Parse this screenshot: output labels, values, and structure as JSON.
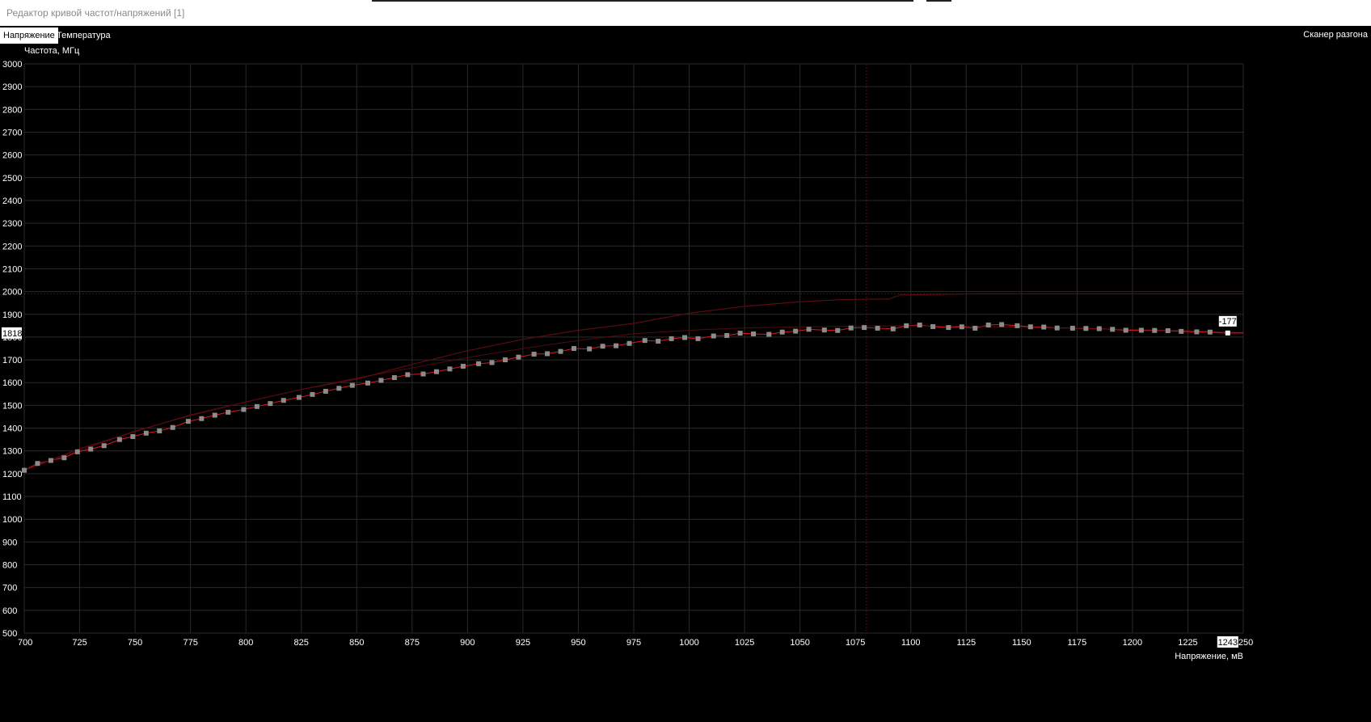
{
  "window": {
    "title": "Редактор кривой частот/напряжений [1]"
  },
  "tabs": [
    {
      "label": "Напряжение",
      "active": true
    },
    {
      "label": "Температура",
      "active": false
    }
  ],
  "toolbar": {
    "scanner_label": "Сканер разгона"
  },
  "colors": {
    "background": "#000000",
    "grid": "#2a2a2a",
    "curve": "#e0141e",
    "curve_dim": "#5a0c10",
    "point": "#8c8c8c",
    "point_selected": "#ffffff"
  },
  "chart_data": {
    "type": "line",
    "ylabel": "Частота, МГц",
    "xlabel": "Напряжение, мВ",
    "xlim": [
      700,
      1250
    ],
    "ylim": [
      500,
      3000
    ],
    "x_ticks": [
      700,
      725,
      750,
      775,
      800,
      825,
      850,
      875,
      900,
      925,
      950,
      975,
      1000,
      1025,
      1050,
      1075,
      1100,
      1125,
      1150,
      1175,
      1200,
      1225,
      1250
    ],
    "y_ticks": [
      500,
      600,
      700,
      800,
      900,
      1000,
      1100,
      1200,
      1300,
      1400,
      1500,
      1600,
      1700,
      1800,
      1900,
      2000,
      2100,
      2200,
      2300,
      2400,
      2500,
      2600,
      2700,
      2800,
      2900,
      3000
    ],
    "grid": true,
    "frequency_limit_mhz": 1990,
    "temperature_limit_voltage_mv": 1080,
    "selected_point": {
      "voltage_mv": 1243,
      "frequency_mhz": 1818,
      "offset_label": "-177"
    },
    "series": [
      {
        "name": "",
        "role": "edited_curve",
        "x": [
          700,
          706,
          712,
          718,
          724,
          730,
          736,
          743,
          749,
          755,
          761,
          767,
          774,
          780,
          786,
          792,
          799,
          805,
          811,
          817,
          824,
          830,
          836,
          842,
          848,
          855,
          861,
          867,
          873,
          880,
          886,
          892,
          898,
          905,
          911,
          917,
          923,
          930,
          936,
          942,
          948,
          955,
          961,
          967,
          973,
          980,
          986,
          992,
          998,
          1004,
          1011,
          1017,
          1023,
          1029,
          1036,
          1042,
          1048,
          1054,
          1061,
          1067,
          1073,
          1079,
          1085,
          1092,
          1098,
          1104,
          1110,
          1117,
          1123,
          1129,
          1135,
          1141,
          1148,
          1154,
          1160,
          1166,
          1173,
          1179,
          1185,
          1191,
          1197,
          1204,
          1210,
          1216,
          1222,
          1229,
          1235,
          1241
        ],
        "y": [
          1215,
          1245,
          1258,
          1270,
          1296,
          1308,
          1323,
          1350,
          1363,
          1378,
          1388,
          1403,
          1430,
          1442,
          1457,
          1470,
          1482,
          1495,
          1508,
          1522,
          1535,
          1548,
          1562,
          1575,
          1588,
          1598,
          1610,
          1622,
          1635,
          1638,
          1648,
          1660,
          1672,
          1683,
          1688,
          1700,
          1712,
          1725,
          1727,
          1737,
          1750,
          1748,
          1760,
          1762,
          1772,
          1785,
          1782,
          1793,
          1798,
          1793,
          1805,
          1807,
          1817,
          1814,
          1812,
          1822,
          1826,
          1834,
          1831,
          1829,
          1840,
          1842,
          1839,
          1836,
          1850,
          1853,
          1846,
          1842,
          1845,
          1839,
          1853,
          1855,
          1850,
          1845,
          1844,
          1840,
          1839,
          1838,
          1837,
          1834,
          1830,
          1830,
          1829,
          1828,
          1825,
          1823,
          1822,
          1818
        ]
      },
      {
        "name": "",
        "role": "default_curve",
        "x": [
          700,
          750,
          775,
          800,
          825,
          850,
          875,
          900,
          925,
          950,
          975,
          1000,
          1025,
          1050,
          1075,
          1100,
          1125,
          1150,
          1175,
          1200,
          1225,
          1250
        ],
        "y": [
          1215,
          1388,
          1455,
          1515,
          1570,
          1620,
          1665,
          1710,
          1750,
          1785,
          1815,
          1830,
          1840,
          1845,
          1848,
          1850,
          1847,
          1843,
          1838,
          1833,
          1828,
          1820
        ]
      },
      {
        "name": "",
        "role": "reference_curve",
        "x": [
          700,
          725,
          750,
          775,
          800,
          825,
          850,
          875,
          900,
          925,
          950,
          975,
          1000,
          1025,
          1050,
          1070,
          1090,
          1095,
          1130,
          1250
        ],
        "y": [
          1215,
          1310,
          1385,
          1458,
          1515,
          1570,
          1615,
          1680,
          1740,
          1790,
          1830,
          1860,
          1905,
          1935,
          1955,
          1965,
          1967,
          1985,
          1990,
          1990
        ]
      }
    ]
  }
}
